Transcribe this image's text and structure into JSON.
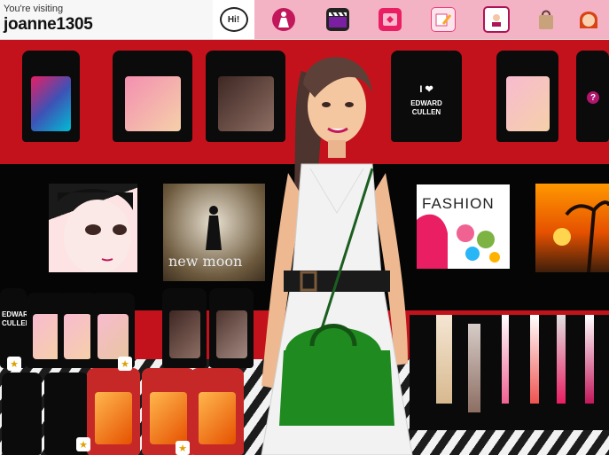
{
  "header": {
    "visiting_label": "You're visiting",
    "username": "joanne1305"
  },
  "tabs": [
    {
      "name": "hi",
      "label": "Hi!",
      "icon": "speech-bubble-icon",
      "color": "#ffffff"
    },
    {
      "name": "dollz",
      "icon": "dress-doll-icon",
      "color": "#c2185b"
    },
    {
      "name": "movies",
      "icon": "clapperboard-icon",
      "color": "#7b1fa2"
    },
    {
      "name": "album",
      "icon": "photo-album-icon",
      "color": "#e91e63"
    },
    {
      "name": "notes",
      "icon": "notepad-pencil-icon",
      "color": "#ec407a"
    },
    {
      "name": "profile",
      "icon": "profile-photo-icon",
      "color": "#ad1457"
    },
    {
      "name": "shop",
      "icon": "shopping-bag-icon",
      "color": "#8d6e63"
    },
    {
      "name": "avatar",
      "icon": "girl-face-icon",
      "color": "#d84315"
    }
  ],
  "room": {
    "help_label": "?",
    "shirt_text": [
      "I ❤",
      "EDWARD",
      "CULLEN"
    ],
    "shirt_text_small": [
      "EDWARD",
      "CULLEN"
    ],
    "poster_newmoon": "new moon",
    "poster_fashion": "FASHION",
    "badge_star": "★"
  },
  "colors": {
    "tab_bar": "#f4b3c4",
    "wall_red": "#c4121c",
    "dress": "#f0f0f0",
    "bag": "#1f8a1f"
  }
}
